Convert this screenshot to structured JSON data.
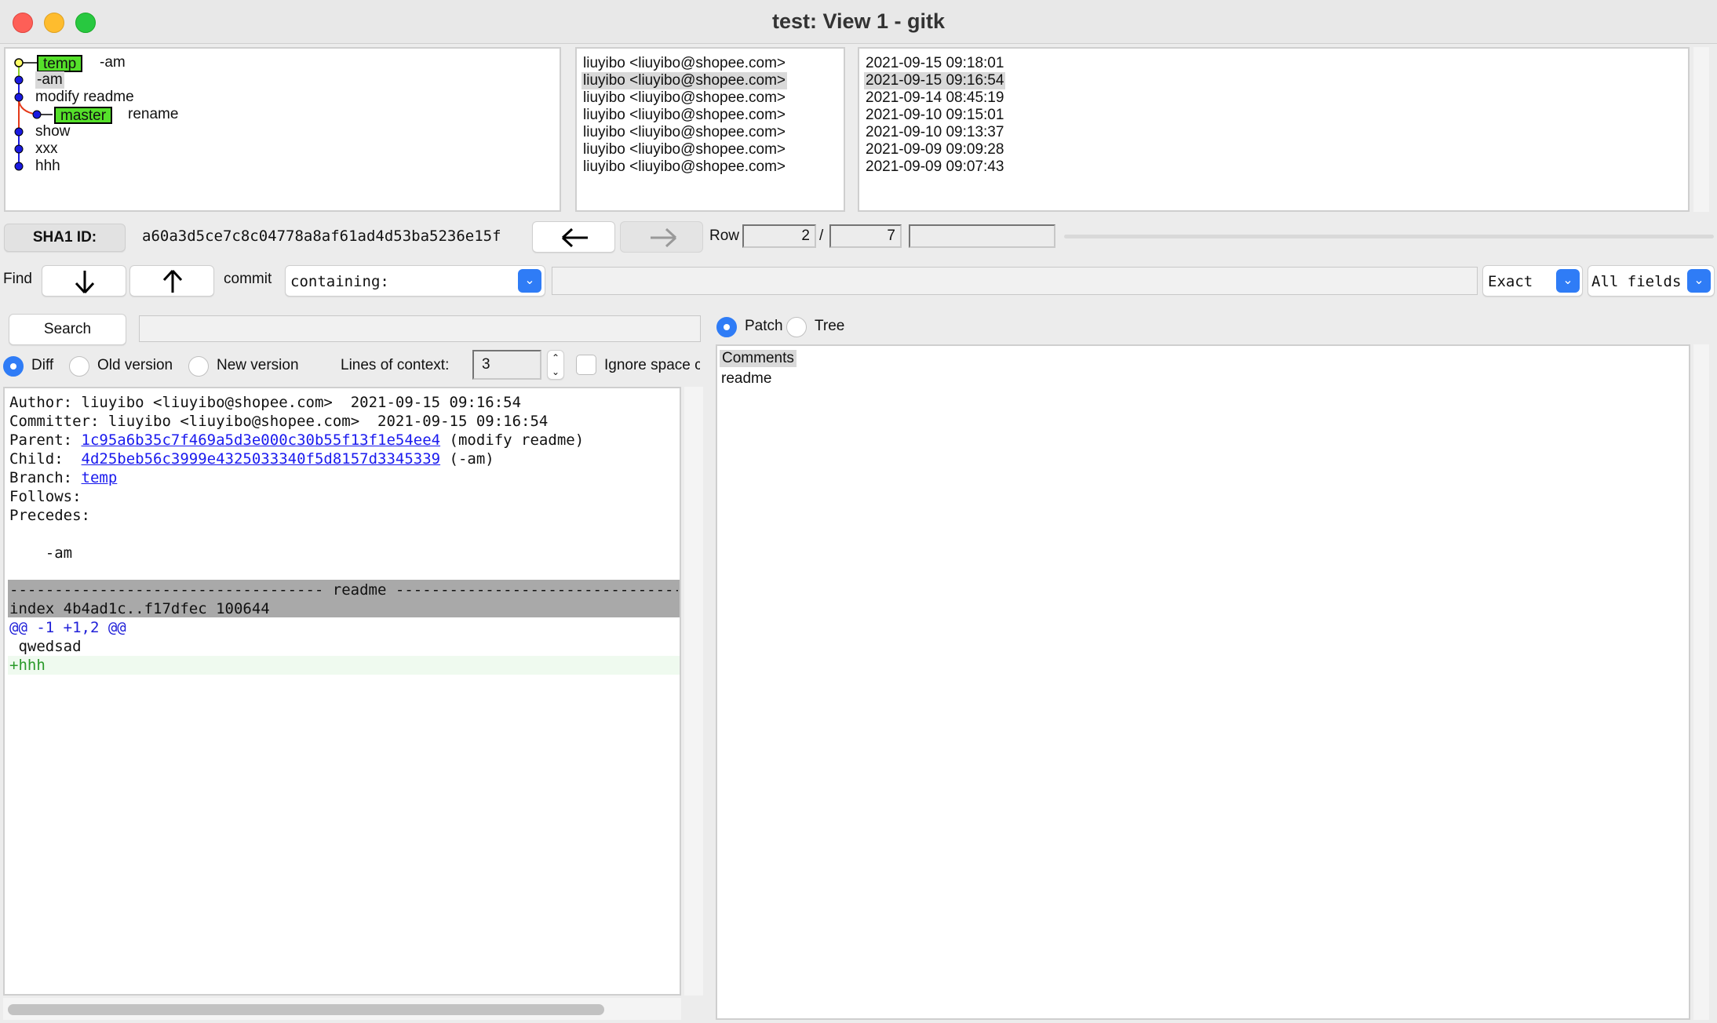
{
  "window": {
    "title": "test: View 1 - gitk"
  },
  "graph": {
    "rows": [
      {
        "label": "-am",
        "ref": "temp"
      },
      {
        "label": "-am"
      },
      {
        "label": "modify readme"
      },
      {
        "label": "rename",
        "ref": "master"
      },
      {
        "label": "show"
      },
      {
        "label": "xxx"
      },
      {
        "label": "hhh"
      }
    ]
  },
  "authors": [
    "liuyibo <liuyibo@shopee.com>",
    "liuyibo <liuyibo@shopee.com>",
    "liuyibo <liuyibo@shopee.com>",
    "liuyibo <liuyibo@shopee.com>",
    "liuyibo <liuyibo@shopee.com>",
    "liuyibo <liuyibo@shopee.com>",
    "liuyibo <liuyibo@shopee.com>"
  ],
  "dates": [
    "2021-09-15 09:18:01",
    "2021-09-15 09:16:54",
    "2021-09-14 08:45:19",
    "2021-09-10 09:15:01",
    "2021-09-10 09:13:37",
    "2021-09-09 09:09:28",
    "2021-09-09 09:07:43"
  ],
  "selected_row": 2,
  "sha": {
    "label": "SHA1 ID:",
    "value": "a60a3d5ce7c8c04778a8af61ad4d53ba5236e15f"
  },
  "nav": {
    "back_icon": "arrow-left-icon",
    "forward_icon": "arrow-right-icon"
  },
  "rowinfo": {
    "label": "Row",
    "current": "2",
    "sep": "/",
    "total": "7"
  },
  "find": {
    "label": "Find",
    "down_icon": "arrow-down-icon",
    "up_icon": "arrow-up-icon",
    "commit_label": "commit",
    "type_value": "containing:",
    "text_value": "",
    "mode_value": "Exact",
    "fields_value": "All fields"
  },
  "search": {
    "button_label": "Search",
    "query": ""
  },
  "diff_opts": {
    "diff_label": "Diff",
    "old_label": "Old version",
    "new_label": "New version",
    "context_label": "Lines of context:",
    "context_value": "3",
    "ignore_label": "Ignore space c"
  },
  "patch_tree": {
    "patch_label": "Patch",
    "tree_label": "Tree",
    "selected": "Patch"
  },
  "files": {
    "header": "Comments",
    "items": [
      "readme"
    ]
  },
  "details": {
    "author_label": "Author:",
    "author_value": "liuyibo <liuyibo@shopee.com>  2021-09-15 09:16:54",
    "committer_label": "Committer:",
    "committer_value": "liuyibo <liuyibo@shopee.com>  2021-09-15 09:16:54",
    "parent_label": "Parent:",
    "parent_hash": "1c95a6b35c7f469a5d3e000c30b55f13f1e54ee4",
    "parent_msg": "(modify readme)",
    "child_label": "Child:",
    "child_hash": "4d25beb56c3999e4325033340f5d8157d3345339",
    "child_msg": "(-am)",
    "branch_label": "Branch:",
    "branch_value": "temp",
    "follows_label": "Follows:",
    "precedes_label": "Precedes:",
    "message": "    -am",
    "file_header": "----------------------------------- readme ------------------------------------",
    "index_line": "index 4b4ad1c..f17dfec 100644",
    "hunk_line": "@@ -1 +1,2 @@",
    "context_line": " qwedsad",
    "added_line": "+hhh"
  },
  "colors": {
    "accent": "#2f7cf6",
    "ref_green": "#55e02a",
    "link": "#1a1aee",
    "added": "#2a9a2a"
  }
}
